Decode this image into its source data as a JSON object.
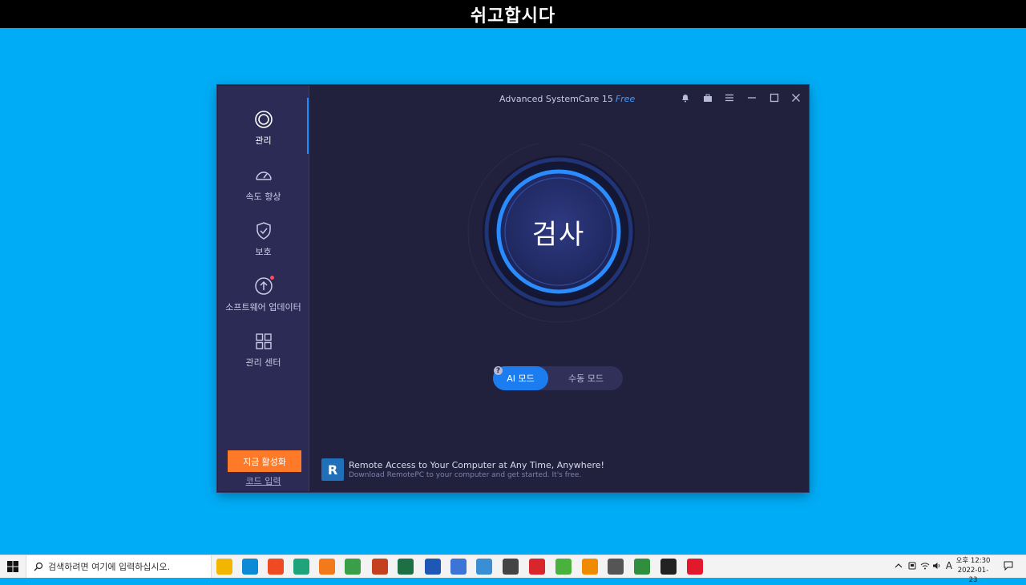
{
  "banner": {
    "text": "쉬고합시다"
  },
  "app": {
    "title": "Advanced SystemCare 15",
    "edition": "Free",
    "sidebar": {
      "items": [
        {
          "label": "관리",
          "icon": "care-ring-icon",
          "active": true
        },
        {
          "label": "속도 향상",
          "icon": "speedometer-icon"
        },
        {
          "label": "보호",
          "icon": "shield-check-icon"
        },
        {
          "label": "소프트웨어 업데이터",
          "icon": "upload-arrow-icon",
          "badge": true
        },
        {
          "label": "관리 센터",
          "icon": "grid-icon"
        }
      ],
      "activate_label": "지금 활성화",
      "code_label": "코드 입력"
    },
    "scan_label": "검사",
    "modes": {
      "ai": "AI 모드",
      "manual": "수동 모드",
      "help": "?"
    },
    "promo": {
      "logo_letter": "R",
      "title": "Remote Access to Your Computer at Any Time, Anywhere!",
      "subtitle": "Download RemotePC to your computer and get started. It's free."
    },
    "colors": {
      "accent": "#1e8cff",
      "activate": "#ff7a28",
      "bg": "#21213d",
      "sidebar": "#2b2b55"
    }
  },
  "taskbar": {
    "search_placeholder": "검색하려면 여기에 입력하십시오.",
    "apps": [
      {
        "name": "file-explorer",
        "color": "#f2b600"
      },
      {
        "name": "edge",
        "color": "#0c8ad6"
      },
      {
        "name": "brave",
        "color": "#f04a23"
      },
      {
        "name": "app-green-swirl",
        "color": "#1fa37a"
      },
      {
        "name": "firefox",
        "color": "#f27a1a"
      },
      {
        "name": "chrome",
        "color": "#3a9f48"
      },
      {
        "name": "powerpoint",
        "color": "#c4401f"
      },
      {
        "name": "excel",
        "color": "#1d7044"
      },
      {
        "name": "word",
        "color": "#1f57b4"
      },
      {
        "name": "hangul",
        "color": "#3c74d8"
      },
      {
        "name": "remote-desktop",
        "color": "#3a8ed4"
      },
      {
        "name": "search-tool",
        "color": "#444444"
      },
      {
        "name": "se-app",
        "color": "#d8262c"
      },
      {
        "name": "green-app",
        "color": "#4ab23c"
      },
      {
        "name": "vlc",
        "color": "#f08a00"
      },
      {
        "name": "calculator",
        "color": "#555555"
      },
      {
        "name": "chrome-beta",
        "color": "#2f8f3e"
      },
      {
        "name": "sticky-notes",
        "color": "#222222"
      },
      {
        "name": "opera",
        "color": "#e2192c"
      }
    ],
    "tray": {
      "ime": "A",
      "time_period": "오후 12:30",
      "date": "2022-01-23"
    }
  }
}
